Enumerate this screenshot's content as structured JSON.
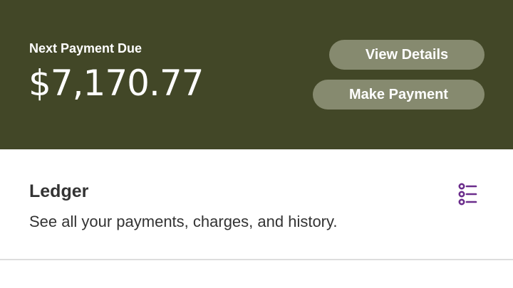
{
  "payment": {
    "label": "Next Payment Due",
    "amount": "$7,170.77",
    "view_details_label": "View Details",
    "make_payment_label": "Make Payment"
  },
  "ledger": {
    "title": "Ledger",
    "description": "See all your payments, charges, and history.",
    "icon": "list-icon"
  },
  "colors": {
    "banner": "#424727",
    "button": "#868a6f",
    "icon_accent": "#6b2d8c"
  }
}
